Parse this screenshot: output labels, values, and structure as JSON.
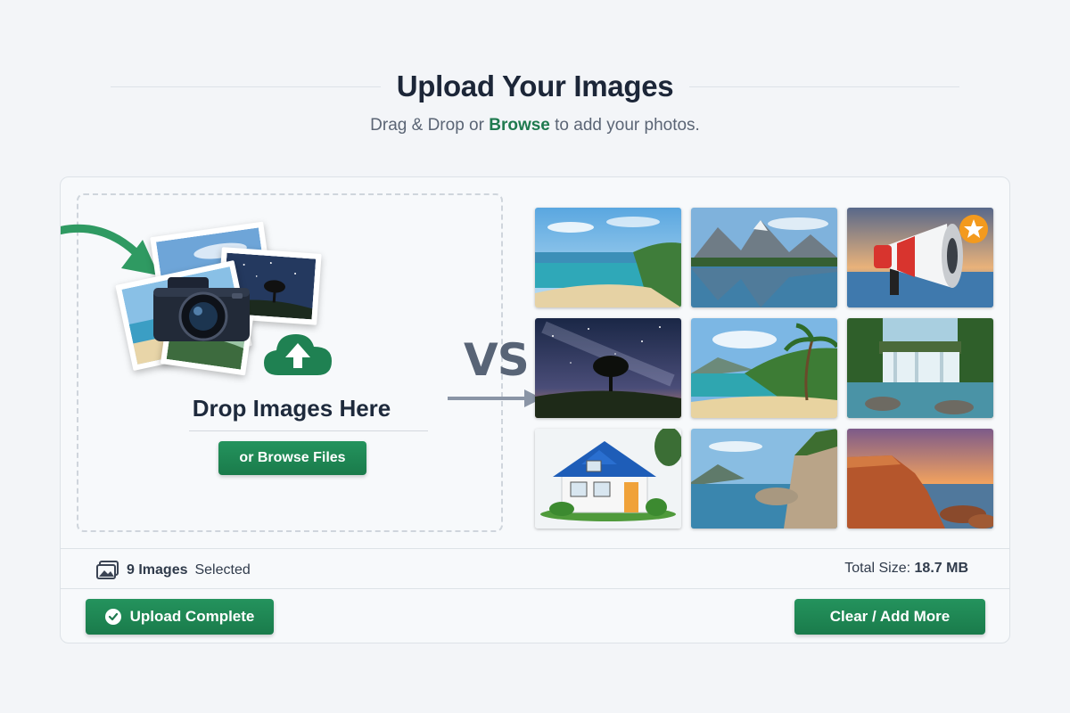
{
  "header": {
    "title": "Upload Your Images",
    "subtitle_before": "Drag & Drop or",
    "subtitle_link": "Browse",
    "subtitle_after": "to add your photos."
  },
  "dropzone": {
    "title": "Drop Images Here",
    "browse_button": "or Browse Files"
  },
  "divider_text": "VS",
  "grid": {
    "thumbnails": [
      {
        "name": "beach"
      },
      {
        "name": "mountain-lake"
      },
      {
        "name": "megaphone"
      },
      {
        "name": "night-sky-tree"
      },
      {
        "name": "tropical-beach"
      },
      {
        "name": "waterfall"
      },
      {
        "name": "house"
      },
      {
        "name": "coastal-cliffs"
      },
      {
        "name": "sunset-rocks"
      }
    ]
  },
  "status": {
    "count": "9 Images",
    "count_suffix": "Selected",
    "total_label": "Total Size:",
    "total_value": "18.7 MB"
  },
  "footer": {
    "complete_label": "Upload Complete",
    "clear_label": "Clear / Add More"
  },
  "colors": {
    "accent": "#1f7a4f",
    "button_top": "#24935d",
    "button_bottom": "#1a7b4b",
    "background": "#f3f5f8"
  }
}
